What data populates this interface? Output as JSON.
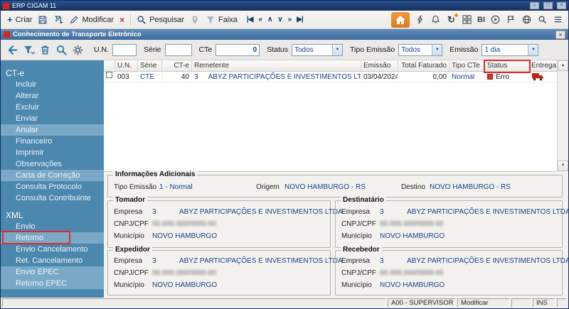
{
  "app": {
    "title": "ERP CIGAM 11"
  },
  "icons": {
    "plus": "+",
    "delete_x": "×",
    "nav_first": "|◀",
    "nav_prev": "«",
    "nav_up": "∧",
    "nav_down": "∨",
    "nav_next": "»",
    "nav_last": "▶|",
    "combo_arrow": "▼",
    "scroll_up": "▲",
    "scroll_down": "▼",
    "sync": "↻",
    "minimize": "–",
    "maximize": "□",
    "close": "×"
  },
  "toolbar": {
    "criar_label": "Criar",
    "modificar_label": "Modificar",
    "pesquisar_label": "Pesquisar",
    "faixa_label": "Faixa",
    "bi_label": "BI"
  },
  "window": {
    "title": "Conhecimento de Transporte Eletrônico"
  },
  "filterbar": {
    "un_label": "U.N.",
    "un_value": "",
    "serie_label": "Série",
    "serie_value": "",
    "cte_label": "CTe",
    "cte_value": "0",
    "status_label": "Status",
    "status_value": "Todos",
    "tipo_emissao_label": "Tipo Emissão",
    "tipo_emissao_value": "Todos",
    "emissao_label": "Emissão",
    "emissao_value": "1 dia"
  },
  "sidebar": {
    "sections": [
      {
        "title": "CT-e",
        "items": [
          {
            "label": "Incluir"
          },
          {
            "label": "Alterar"
          },
          {
            "label": "Excluir"
          },
          {
            "label": "Enviar"
          },
          {
            "label": "Anular",
            "highlighted": true
          },
          {
            "label": "Financeiro"
          },
          {
            "label": "Imprimir"
          },
          {
            "label": "Observações"
          },
          {
            "label": "Carta de Correção",
            "highlighted": true
          },
          {
            "label": "Consulta Protocolo"
          },
          {
            "label": "Consulta Contribuinte"
          }
        ]
      },
      {
        "title": "XML",
        "items": [
          {
            "label": "Envio"
          },
          {
            "label": "Retorno",
            "highlighted": true,
            "annotated": true
          },
          {
            "label": "Envio Cancelamento"
          },
          {
            "label": "Ret. Cancelamento"
          },
          {
            "label": "Envio EPEC",
            "highlighted": true
          },
          {
            "label": "Retorno EPEC",
            "highlighted": true
          }
        ]
      }
    ]
  },
  "grid": {
    "columns": [
      "U.N.",
      "Série",
      "CT-e",
      "Remetente",
      "Emissão",
      "Total Faturado",
      "Tipo CTe",
      "Status",
      "Entrega"
    ],
    "row": {
      "un": "003",
      "serie": "CTE",
      "cte": "40",
      "remetente_codigo": "3",
      "remetente_nome": "ABYZ PARTICIPAÇÕES E INVESTIMENTOS LTDA",
      "emissao": "03/04/2024",
      "total_faturado": "0,00",
      "tipo_cte": "Normal",
      "status": "Erro"
    }
  },
  "info": {
    "title": "Informações Adicionais",
    "tipo_emissao_label": "Tipo Emissão",
    "tipo_emissao_value": "1 - Normal",
    "origem_label": "Origem",
    "origem_value": "NOVO HAMBURGO - RS",
    "destino_label": "Destino",
    "destino_value": "NOVO HAMBURGO - RS"
  },
  "panels": [
    {
      "title": "Tomador",
      "empresa_label": "Empresa",
      "empresa_codigo": "3",
      "empresa_nome": "ABYZ PARTICIPAÇÕES E INVESTIMENTOS LTDA",
      "cnpj_label": "CNPJ/CPF",
      "cnpj_value": "00.000.000/0000-00",
      "municipio_label": "Município",
      "municipio_value": "NOVO HAMBURGO"
    },
    {
      "title": "Destinatário",
      "empresa_label": "Empresa",
      "empresa_codigo": "3",
      "empresa_nome": "ABYZ PARTICIPAÇÕES E INVESTIMENTOS LTDA",
      "cnpj_label": "CNPJ/CPF",
      "cnpj_value": "00.000.000/0000-00",
      "municipio_label": "Município",
      "municipio_value": "NOVO HAMBURGO"
    },
    {
      "title": "Expedidor",
      "empresa_label": "Empresa",
      "empresa_codigo": "3",
      "empresa_nome": "ABYZ PARTICIPAÇÕES E INVESTIMENTOS LTDA",
      "cnpj_label": "CNPJ/CPF",
      "cnpj_value": "00.000.000/0000-00",
      "municipio_label": "Município",
      "municipio_value": "NOVO HAMBURGO"
    },
    {
      "title": "Recebedor",
      "empresa_label": "Empresa",
      "empresa_codigo": "3",
      "empresa_nome": "ABYZ PARTICIPAÇÕES E INVESTIMENTOS LTDA",
      "cnpj_label": "CNPJ/CPF",
      "cnpj_value": "00.000.000/0000-00",
      "municipio_label": "Município",
      "municipio_value": "NOVO HAMBURGO"
    }
  ],
  "statusbar": {
    "user": "A00 - SUPERVISOR",
    "mode": "Modificar",
    "ins": "INS"
  }
}
